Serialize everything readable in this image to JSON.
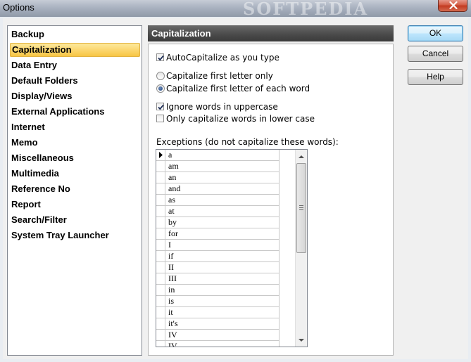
{
  "window": {
    "title": "Options",
    "watermark": "SOFTPEDIA"
  },
  "sidebar": {
    "selected_index": 1,
    "items": [
      {
        "label": "Backup"
      },
      {
        "label": "Capitalization"
      },
      {
        "label": "Data Entry"
      },
      {
        "label": "Default Folders"
      },
      {
        "label": "Display/Views"
      },
      {
        "label": "External Applications"
      },
      {
        "label": "Internet"
      },
      {
        "label": "Memo"
      },
      {
        "label": "Miscellaneous"
      },
      {
        "label": "Multimedia"
      },
      {
        "label": "Reference No"
      },
      {
        "label": "Report"
      },
      {
        "label": "Search/Filter"
      },
      {
        "label": "System Tray Launcher"
      }
    ]
  },
  "panel": {
    "title": "Capitalization",
    "auto_capitalize": {
      "label": "AutoCapitalize as you type",
      "checked": true
    },
    "radio_first_only": {
      "label": "Capitalize first letter only",
      "selected": false
    },
    "radio_each_word": {
      "label": "Capitalize first letter of each word",
      "selected": true
    },
    "ignore_uppercase": {
      "label": "Ignore words in uppercase",
      "checked": true
    },
    "only_lowercase": {
      "label": "Only capitalize words in lower case",
      "checked": false
    },
    "exceptions_label": "Exceptions (do not capitalize these words):",
    "exceptions": [
      "a",
      "am",
      "an",
      "and",
      "as",
      "at",
      "by",
      "for",
      "I",
      "if",
      "II",
      "III",
      "in",
      "is",
      "it",
      "it's",
      "IV",
      "IV"
    ]
  },
  "buttons": {
    "ok": "OK",
    "cancel": "Cancel",
    "help": "Help"
  },
  "colors": {
    "selection": "#fbd56c",
    "header": "#4b4b4b",
    "default_button": "#3c7fb1"
  }
}
